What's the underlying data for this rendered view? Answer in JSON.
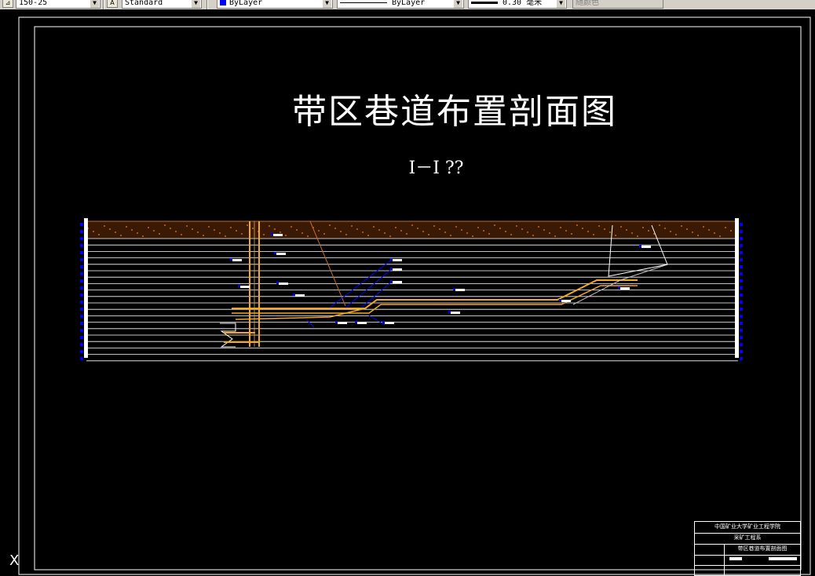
{
  "toolbar": {
    "dimstyle_value": "150-25",
    "textstyle_value": "Standard",
    "color_value": "ByLayer",
    "linetype_value": "ByLayer",
    "lineweight_value": "0.30 毫米",
    "plotstyle_value": "随颜色",
    "colors": {
      "bylayer_swatch": "#0000ff"
    }
  },
  "drawing": {
    "title": "带区巷道布置剖面图",
    "section_label": "I－I ??",
    "colors": {
      "background": "#000000",
      "frame": "#ffffff",
      "strata": "#ffffff",
      "roadway": "#f5a623",
      "surface_soil": "#c86a1e",
      "markers": "#0000ff"
    },
    "title_block": {
      "school": "中国矿业大学矿业工程学院",
      "department": "采矿工程系",
      "drawing_name": "带区巷道布置剖面图"
    },
    "ucs_icon": "ucs-x-icon"
  }
}
